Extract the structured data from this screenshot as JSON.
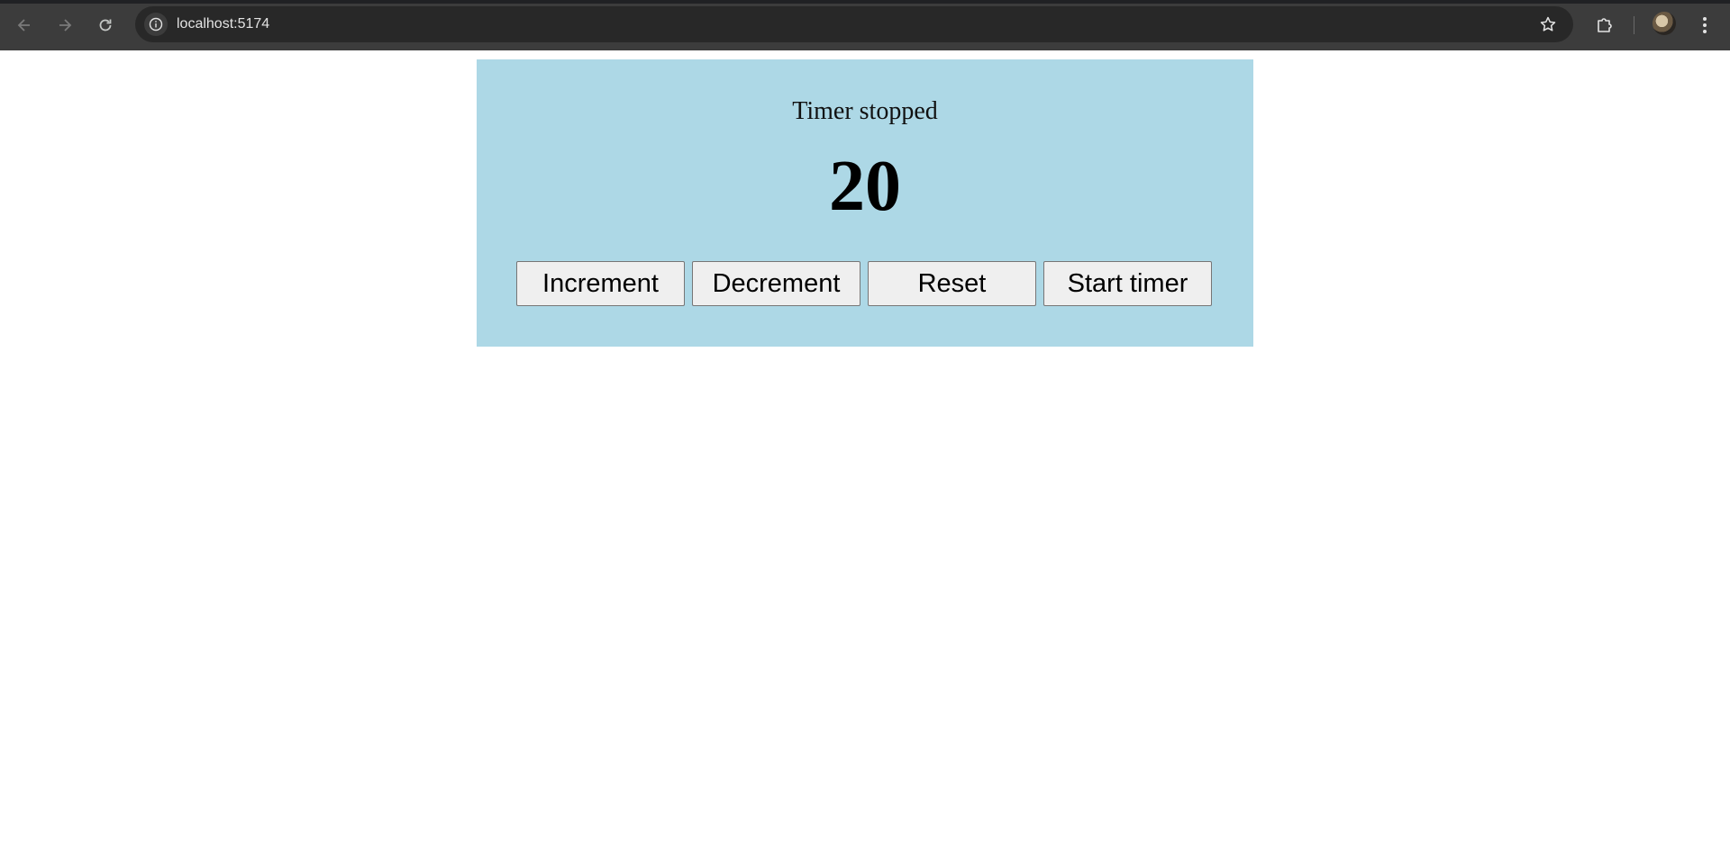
{
  "browser": {
    "url": "localhost:5174",
    "icons": {
      "back": "arrow-left-icon",
      "forward": "arrow-right-icon",
      "reload": "reload-icon",
      "site_info": "info-icon",
      "bookmark": "star-icon",
      "extensions": "puzzle-icon",
      "profile": "avatar",
      "menu": "kebab-menu-icon"
    }
  },
  "app": {
    "background_color": "#add8e6",
    "status": "Timer stopped",
    "count": "20",
    "buttons": {
      "increment": "Increment",
      "decrement": "Decrement",
      "reset": "Reset",
      "start_timer": "Start timer"
    }
  }
}
